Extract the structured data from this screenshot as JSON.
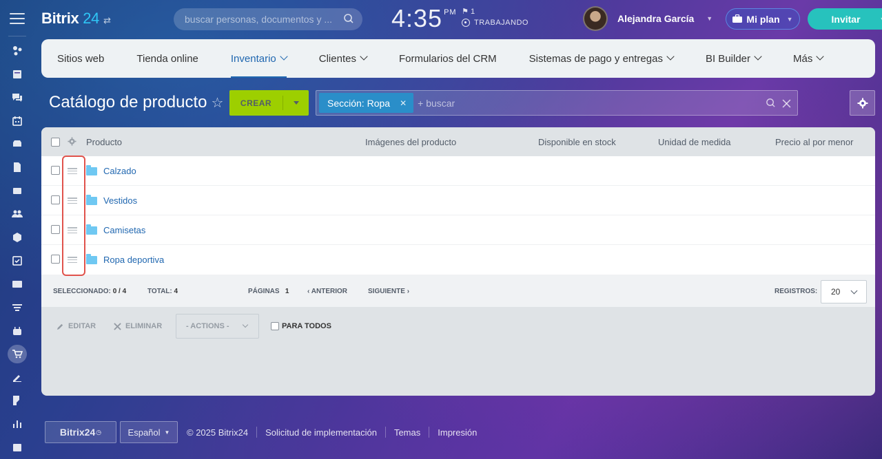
{
  "header": {
    "logo_name": "Bitrix",
    "logo_num": "24",
    "search_placeholder": "buscar personas, documentos y ...",
    "clock_time": "4:35",
    "clock_ampm": "PM",
    "flag_count": "1",
    "work_status": "TRABAJANDO",
    "user_name": "Alejandra García",
    "plan_label": "Mi plan",
    "invite_label": "Invitar"
  },
  "topnav": [
    {
      "label": "Sitios web",
      "dropdown": false,
      "active": false
    },
    {
      "label": "Tienda online",
      "dropdown": false,
      "active": false
    },
    {
      "label": "Inventario",
      "dropdown": true,
      "active": true
    },
    {
      "label": "Clientes",
      "dropdown": true,
      "active": false
    },
    {
      "label": "Formularios del CRM",
      "dropdown": false,
      "active": false
    },
    {
      "label": "Sistemas de pago y entregas",
      "dropdown": true,
      "active": false
    },
    {
      "label": "BI Builder",
      "dropdown": true,
      "active": false
    },
    {
      "label": "Más",
      "dropdown": true,
      "active": false
    }
  ],
  "page": {
    "title": "Catálogo de producto",
    "create_label": "CREAR",
    "filter_chip": "Sección: Ropa",
    "filter_placeholder": "+ buscar"
  },
  "grid": {
    "columns": [
      "Producto",
      "Imágenes del producto",
      "Disponible en stock",
      "Unidad de medida",
      "Precio al por menor"
    ],
    "rows": [
      "Calzado",
      "Vestidos",
      "Camisetas",
      "Ropa deportiva"
    ],
    "selected_label": "SELECCIONADO:",
    "selected_value": "0 / 4",
    "total_label": "TOTAL:",
    "total_value": "4",
    "pages_label": "PÁGINAS",
    "pages_value": "1",
    "prev_label": "ANTERIOR",
    "next_label": "SIGUIENTE",
    "records_label": "REGISTROS:",
    "records_value": "20"
  },
  "actions": {
    "edit": "EDITAR",
    "delete": "ELIMINAR",
    "select": "- ACTIONS -",
    "for_all": "PARA TODOS"
  },
  "footer": {
    "brand": "Bitrix24",
    "language": "Español",
    "copyright": "© 2025 Bitrix24",
    "links": [
      "Solicitud de implementación",
      "Temas",
      "Impresión"
    ]
  },
  "colors": {
    "accent": "#2067b0",
    "create": "#9dcf00",
    "invite": "#27c2bd",
    "chip": "#2a8ec9",
    "highlight": "#e0524b"
  }
}
